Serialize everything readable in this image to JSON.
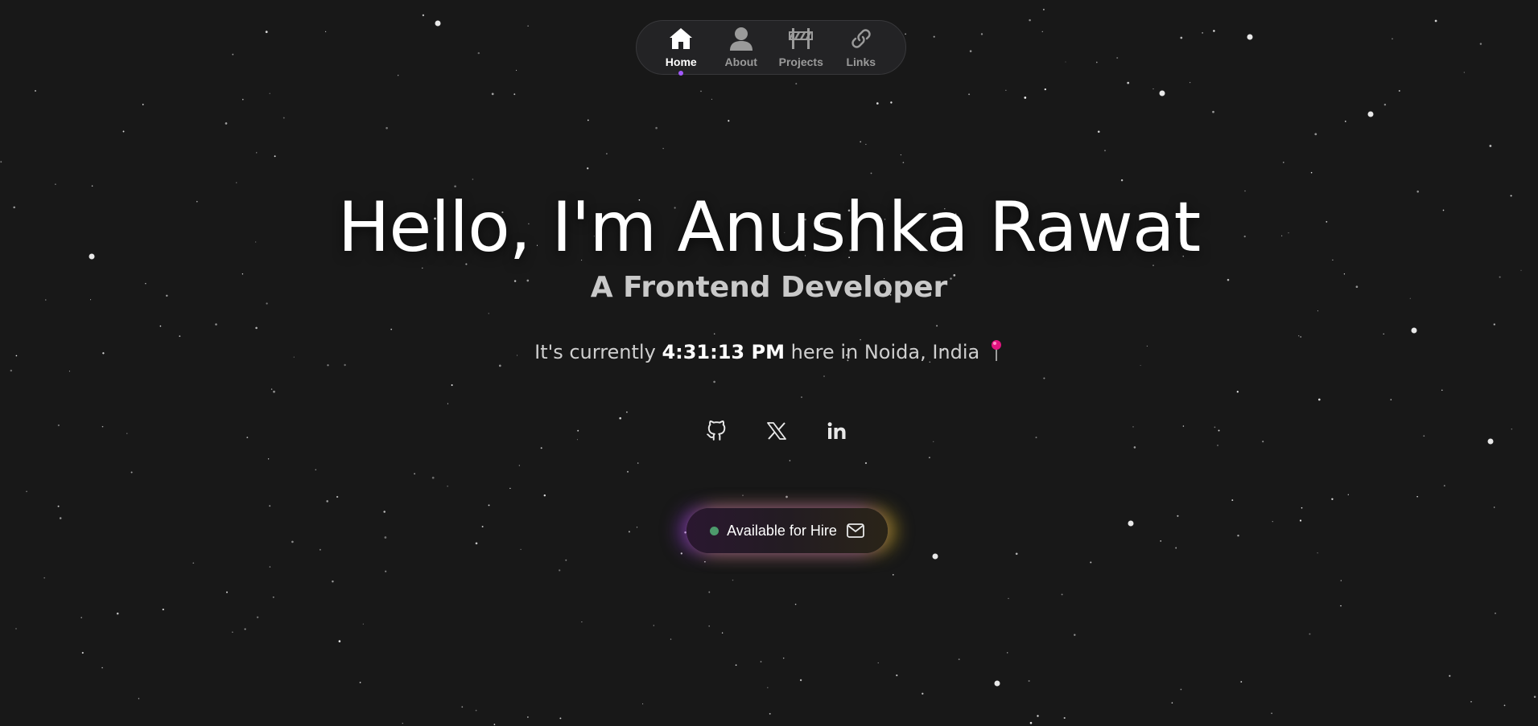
{
  "nav": {
    "items": [
      {
        "label": "Home",
        "icon": "home-icon",
        "active": true
      },
      {
        "label": "About",
        "icon": "user-icon",
        "active": false
      },
      {
        "label": "Projects",
        "icon": "barrier-icon",
        "active": false
      },
      {
        "label": "Links",
        "icon": "link-icon",
        "active": false
      }
    ],
    "active_indicator_color": "#a259ff"
  },
  "hero": {
    "title": "Hello, I'm Anushka Rawat",
    "subtitle": "A Frontend Developer",
    "time_prefix": "It's currently",
    "time_value": "4:31:13 PM",
    "time_suffix": "here in Noida, India",
    "pin_icon": "pushpin-icon"
  },
  "socials": [
    {
      "name": "GitHub",
      "icon": "github-icon"
    },
    {
      "name": "X",
      "icon": "x-icon"
    },
    {
      "name": "LinkedIn",
      "icon": "linkedin-icon"
    }
  ],
  "hire_button": {
    "label": "Available for Hire",
    "status_color": "#4d9a6c",
    "icon": "mail-icon"
  },
  "colors": {
    "background": "#181818",
    "accent_purple": "#a259ff",
    "pin": "#e0157f"
  }
}
